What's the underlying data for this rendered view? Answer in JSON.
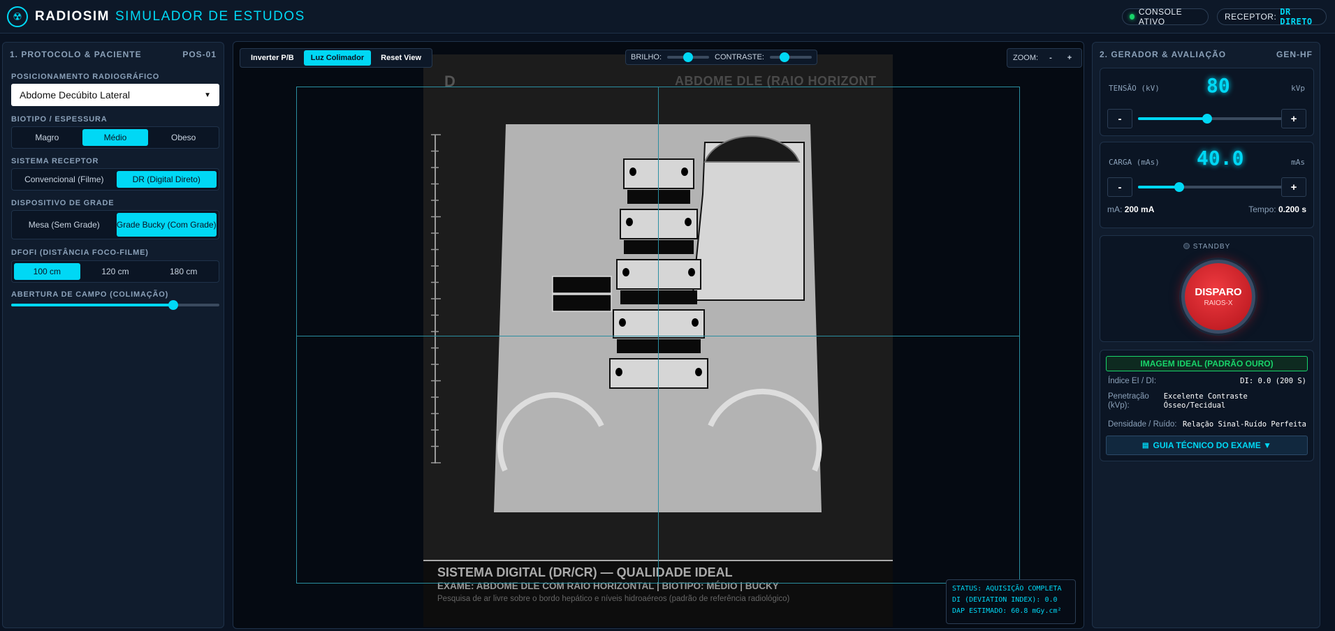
{
  "header": {
    "brand": "RADIOSIM",
    "subtitle": "SIMULADOR DE ESTUDOS",
    "console_status": "CONSOLE ATIVO",
    "receptor_label": "RECEPTOR:",
    "receptor_value": "DR DIRETO"
  },
  "left_panel": {
    "title": "1. PROTOCOLO & PACIENTE",
    "code": "POS-01",
    "positioning_label": "POSICIONAMENTO RADIOGRÁFICO",
    "positioning_value": "Abdome Decúbito Lateral",
    "biotype_label": "BIOTIPO / ESPESSURA",
    "biotypes": [
      "Magro",
      "Médio",
      "Obeso"
    ],
    "receptor_system_label": "SISTEMA RECEPTOR",
    "receptor_systems": [
      "Convencional (Filme)",
      "DR (Digital Direto)"
    ],
    "grid_label": "DISPOSITIVO DE GRADE",
    "grids": [
      "Mesa (Sem Grade)",
      "Grade Bucky (Com Grade)"
    ],
    "dfofi_label": "DFOFI (DISTÂNCIA FOCO-FILME)",
    "distances": [
      "100 cm",
      "120 cm",
      "180 cm"
    ],
    "collimation_label": "ABERTURA DE CAMPO (COLIMAÇÃO)",
    "collimation_level": 0.78
  },
  "viewer": {
    "invert_btn": "Inverter P/B",
    "collimator_btn": "Luz Colimador",
    "reset_btn": "Reset View",
    "brightness_label": "BRILHO:",
    "brightness_level": 0.5,
    "contrast_label": "CONTRASTE:",
    "contrast_level": 0.35,
    "zoom_label": "ZOOM:",
    "zoom_out": "-",
    "zoom_in": "+",
    "marker": "D",
    "image_title": "ABDOME DLE (RAIO HORIZONT",
    "caption_title": "SISTEMA DIGITAL (DR/CR) — QUALIDADE IDEAL",
    "caption_exam": "EXAME: ABDOME DLE COM RAIO HORIZONTAL | BIOTIPO: MÉDIO | BUCKY",
    "caption_desc": "Pesquisa de ar livre sobre o bordo hepático e níveis hidroaéreos (padrão de referência radiológico)",
    "status_line1": "STATUS: AQUISIÇÃO COMPLETA",
    "status_line2": "DI (DEVIATION INDEX): 0.0",
    "status_line3": "DAP ESTIMADO: 60.8 mGy.cm²"
  },
  "right_panel": {
    "title": "2. GERADOR & AVALIAÇÃO",
    "code": "GEN-HF",
    "kv_label": "TENSÃO (kV)",
    "kv_value": "80",
    "kv_unit": "kVp",
    "kv_level": 0.47,
    "mas_label": "CARGA (mAs)",
    "mas_value": "40.0",
    "mas_unit": "mAs",
    "mas_level": 0.28,
    "minus": "-",
    "plus": "+",
    "ma_label": "mA:",
    "ma_value": "200 mA",
    "time_label": "Tempo:",
    "time_value": "0.200 s",
    "standby": "STANDBY",
    "fire_label": "DISPARO",
    "fire_sub": "RAIOS-X",
    "result_badge": "IMAGEM IDEAL (PADRÃO OURO)",
    "ei_label": "Índice EI / DI:",
    "ei_value": "DI: 0.0 (200 S)",
    "penetration_label": "Penetração (kVp):",
    "penetration_value": "Excelente Contraste Ósseo/Tecidual",
    "density_label": "Densidade / Ruído:",
    "density_value": "Relação Sinal-Ruído Perfeita",
    "guide_btn": "GUIA TÉCNICO DO EXAME ▼"
  },
  "colors": {
    "accent": "#00d8f5",
    "ok": "#18d46a",
    "fire": "#d81f26"
  }
}
